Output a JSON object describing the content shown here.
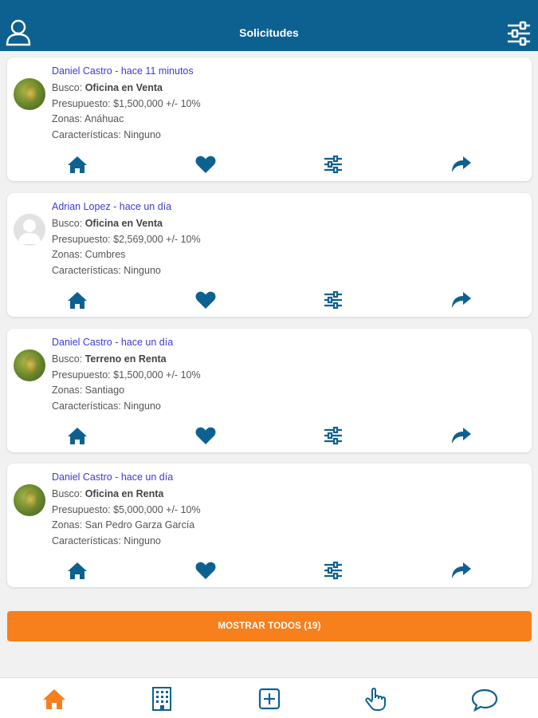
{
  "header": {
    "title": "Solicitudes",
    "user_icon": "user-icon",
    "filter_icon": "sliders-icon"
  },
  "colors": {
    "header_bg": "#0d6190",
    "accent": "#f77f1c",
    "icon": "#0d6190",
    "author_link": "#3b3bd6"
  },
  "requests": [
    {
      "author": "Daniel Castro - hace 11 minutos",
      "avatar": "photo",
      "busco_label": "Busco:",
      "busco_value": "Oficina en Venta",
      "presupuesto": "Presupuesto: $1,500,000 +/- 10%",
      "zonas": "Zonas: Anáhuac",
      "caracteristicas": "Características: Ninguno"
    },
    {
      "author": "Adrian Lopez - hace un día",
      "avatar": "placeholder",
      "busco_label": "Busco:",
      "busco_value": "Oficina en Venta",
      "presupuesto": "Presupuesto: $2,569,000 +/- 10%",
      "zonas": "Zonas: Cumbres",
      "caracteristicas": "Características: Ninguno"
    },
    {
      "author": "Daniel Castro - hace un día",
      "avatar": "photo",
      "busco_label": "Busco:",
      "busco_value": "Terreno en Renta",
      "presupuesto": "Presupuesto: $1,500,000 +/- 10%",
      "zonas": "Zonas: Santiago",
      "caracteristicas": "Características: Ninguno"
    },
    {
      "author": "Daniel Castro - hace un día",
      "avatar": "photo",
      "busco_label": "Busco:",
      "busco_value": "Oficina en Renta",
      "presupuesto": "Presupuesto: $5,000,000 +/- 10%",
      "zonas": "Zonas: San Pedro Garza García",
      "caracteristicas": "Características: Ninguno"
    }
  ],
  "card_actions": [
    "home-icon",
    "heart-icon",
    "sliders-icon",
    "share-icon"
  ],
  "show_all_label": "MOSTRAR TODOS (19)",
  "tabbar": {
    "items": [
      "home-icon",
      "building-icon",
      "add-icon",
      "hand-pointer-icon",
      "chat-icon"
    ]
  }
}
